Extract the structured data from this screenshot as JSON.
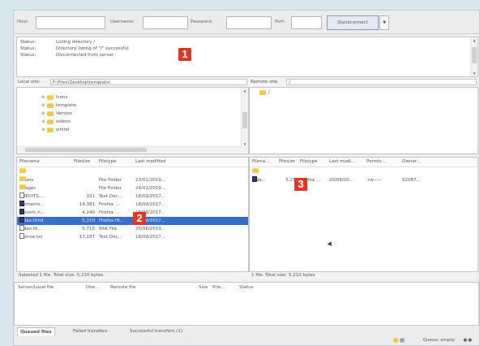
{
  "quickconnect": {
    "host_label": "Host:",
    "username_label": "Username:",
    "password_label": "Password:",
    "port_label": "Port:",
    "host_value": "",
    "username_value": "",
    "password_value": "",
    "port_value": "",
    "connect_label": "Quickconnect",
    "dropdown_icon": "chevron-down-icon"
  },
  "message_log": [
    {
      "status": "Status:",
      "message": "Listing directory /"
    },
    {
      "status": "Status:",
      "message": "Directory listing of \"/\" successful"
    },
    {
      "status": "Status:",
      "message": "Disconnected from server"
    }
  ],
  "callouts": {
    "one": "1",
    "two": "2",
    "three": "3"
  },
  "local": {
    "site_label": "Local site:",
    "path": "F:\\Files\\Desktop\\template\\",
    "tree": [
      {
        "name": "Icons"
      },
      {
        "name": "template"
      },
      {
        "name": "Version"
      },
      {
        "name": "videos"
      },
      {
        "name": "whitel"
      }
    ],
    "columns": [
      "Filename",
      "Filesize",
      "Filetype",
      "Last modified"
    ],
    "files": [
      {
        "name": "..",
        "size": "",
        "type": "",
        "modified": "",
        "icon": "folder"
      },
      {
        "name": "assets",
        "size": "",
        "type": "File Folder",
        "modified": "23/01/2019...",
        "icon": "folder"
      },
      {
        "name": "images",
        "size": "",
        "type": "File Folder",
        "modified": "24/01/2019...",
        "icon": "folder"
      },
      {
        "name": "CREDITS...",
        "size": "331",
        "type": "Text Doc...",
        "modified": "18/09/2017...",
        "icon": "file"
      },
      {
        "name": "elements...",
        "size": "14,381",
        "type": "Firefox ...",
        "modified": "18/09/2017...",
        "icon": "dark"
      },
      {
        "name": "generic.h...",
        "size": "4,240",
        "type": "Firefox ...",
        "modified": "18/09/2017...",
        "icon": "dark"
      },
      {
        "name": "index.html",
        "size": "5,210",
        "type": "Firefox HI...",
        "modified": "23/09/2017...",
        "icon": "dark"
      },
      {
        "name": "index.ht...",
        "size": "5,710",
        "type": "BAK File",
        "modified": "25/08/2019...",
        "icon": "file"
      },
      {
        "name": "license.txt",
        "size": "17,187",
        "type": "Text Doc...",
        "modified": "18/09/2017...",
        "icon": "file"
      }
    ],
    "selected_index": 6,
    "status": "Selected 1 file. Total size: 5,210 bytes"
  },
  "remote": {
    "site_label": "Remote site:",
    "path": "/",
    "tree": [
      {
        "name": "/"
      }
    ],
    "columns": [
      "Filena...",
      "Filesize",
      "Filetype",
      "Last modi...",
      "Permis...",
      "Owner..."
    ],
    "files": [
      {
        "name": "..",
        "size": "",
        "type": "",
        "modified": "",
        "perms": "",
        "owner": "",
        "icon": "folder"
      },
      {
        "name": "inde...",
        "size": "5,210",
        "type": "Firefox ...",
        "modified": "20/08/20...",
        "perms": "-rw-----",
        "owner": "62087...",
        "icon": "dark"
      }
    ],
    "status": "1 file. Total size: 5,210 bytes"
  },
  "queue": {
    "columns": [
      "Server/Local file",
      "Dire...",
      "Remote file",
      "Size",
      "Prio...",
      "Status"
    ],
    "tabs": [
      "Queued files",
      "Failed transfers",
      "Successful transfers (1)"
    ],
    "active_tab": 0,
    "footer": "Queue: empty"
  }
}
